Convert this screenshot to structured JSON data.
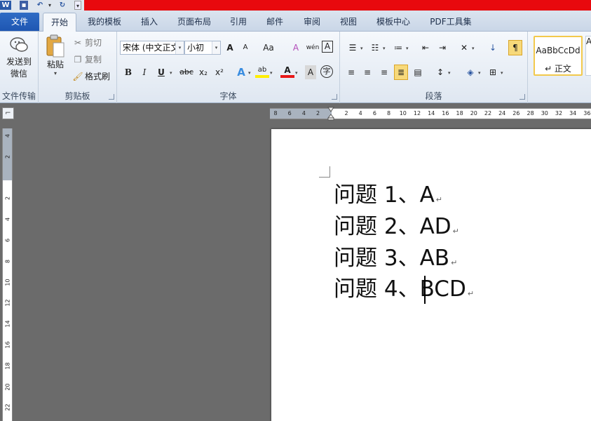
{
  "quick_access": {
    "logo": "W",
    "icons": [
      "word-logo",
      "save-icon",
      "undo-icon",
      "redo-icon",
      "customize-icon"
    ]
  },
  "tabs": [
    {
      "label": "文件"
    },
    {
      "label": "开始"
    },
    {
      "label": "我的模板"
    },
    {
      "label": "插入"
    },
    {
      "label": "页面布局"
    },
    {
      "label": "引用"
    },
    {
      "label": "邮件"
    },
    {
      "label": "审阅"
    },
    {
      "label": "视图"
    },
    {
      "label": "模板中心"
    },
    {
      "label": "PDF工具集"
    }
  ],
  "ribbon": {
    "send": {
      "label_line1": "发送到",
      "label_line2": "微信",
      "group": "文件传输"
    },
    "clipboard": {
      "paste": "粘贴",
      "cut": "剪切",
      "copy": "复制",
      "format_painter": "格式刷",
      "group": "剪贴板"
    },
    "font": {
      "name": "宋体 (中文正文)",
      "size": "小初",
      "group": "字体",
      "buttons": {
        "grow": "A",
        "shrink": "A",
        "case": "Aa",
        "clear": "A",
        "bold": "B",
        "italic": "I",
        "underline": "U",
        "strike": "abc",
        "sub": "x₂",
        "sup": "x²",
        "effects": "A",
        "highlight": "ab",
        "color": "A",
        "shade": "A",
        "enclose": "字",
        "phonetic": "wén",
        "border": "A"
      }
    },
    "paragraph": {
      "group": "段落"
    },
    "styles": {
      "sample": "AaBbCcDd",
      "name": "↵ 正文"
    }
  },
  "hruler_ticks": [
    "8",
    "6",
    "4",
    "2",
    "",
    "2",
    "4",
    "6",
    "8",
    "10",
    "12",
    "14",
    "16",
    "18",
    "20",
    "22",
    "24",
    "26",
    "28",
    "30",
    "32",
    "34",
    "36"
  ],
  "vruler_ticks": [
    "4",
    "2",
    "",
    "2",
    "4",
    "6",
    "8",
    "10",
    "12",
    "14",
    "16",
    "18",
    "20",
    "22"
  ],
  "document": {
    "lines": [
      {
        "text": "问题 1、A"
      },
      {
        "text": "问题 2、AD"
      },
      {
        "text": "问题 3、AB"
      },
      {
        "text": "问题 4、BCD"
      }
    ],
    "para_mark": "↵"
  },
  "colors": {
    "accent": "#1e56b2",
    "title_red": "#e8090e",
    "highlight": "#f2c94c",
    "font_color": "#e81818",
    "highlight_color": "#ffee00"
  }
}
